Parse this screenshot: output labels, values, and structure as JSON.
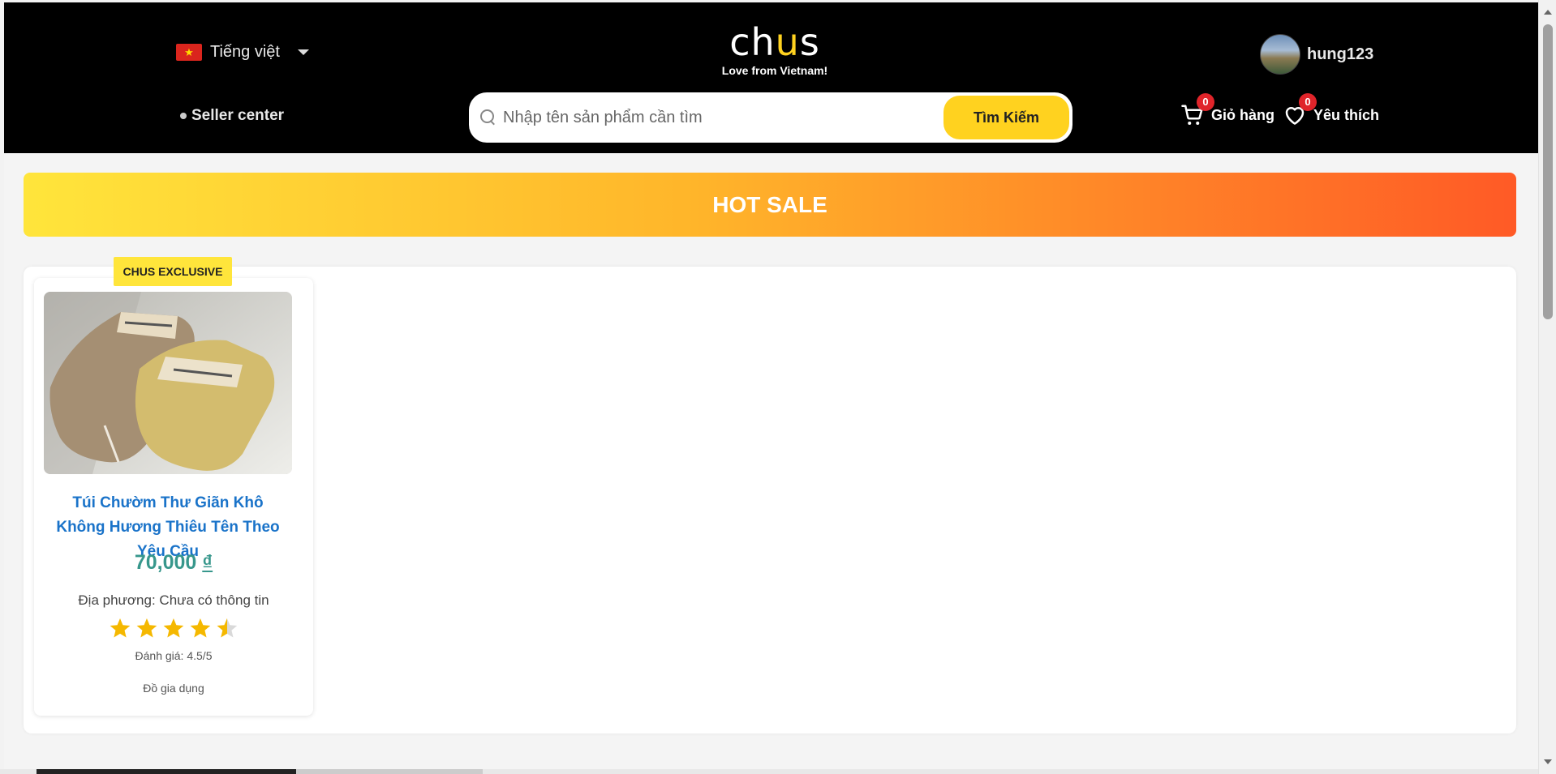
{
  "header": {
    "language": "Tiếng việt",
    "seller_center": "Seller center",
    "logo_text": {
      "before": "ch",
      "accent": "u",
      "after": "s"
    },
    "logo_tagline": "Love from Vietnam!",
    "search_placeholder": "Nhập tên sản phẩm cần tìm",
    "search_button": "Tìm Kiếm",
    "username": "hung123",
    "cart_label": "Giỏ hàng",
    "cart_count": "0",
    "wishlist_label": "Yêu thích",
    "wishlist_count": "0"
  },
  "banner": {
    "title": "HOT SALE"
  },
  "products": [
    {
      "badge": "CHUS EXCLUSIVE",
      "name": "Túi Chườm Thư Giãn Khô Không Hương Thiêu Tên Theo Yêu Cầu",
      "price": "70,000",
      "currency": "₫",
      "origin": "Địa phương: Chưa có thông tin",
      "rating_value": 4.5,
      "rating_max": 5,
      "rating_text": "Đánh giá: 4.5/5",
      "category": "Đồ gia dụng"
    }
  ],
  "colors": {
    "header_bg": "#000000",
    "accent_yellow": "#ffd21f",
    "product_name": "#1a73c9",
    "price": "#37978c",
    "badge_red": "#e0242a",
    "star": "#f5b800"
  },
  "icons": [
    "vietnam-flag-icon",
    "chevron-down-icon",
    "search-icon",
    "cart-icon",
    "heart-icon",
    "star-icon"
  ]
}
